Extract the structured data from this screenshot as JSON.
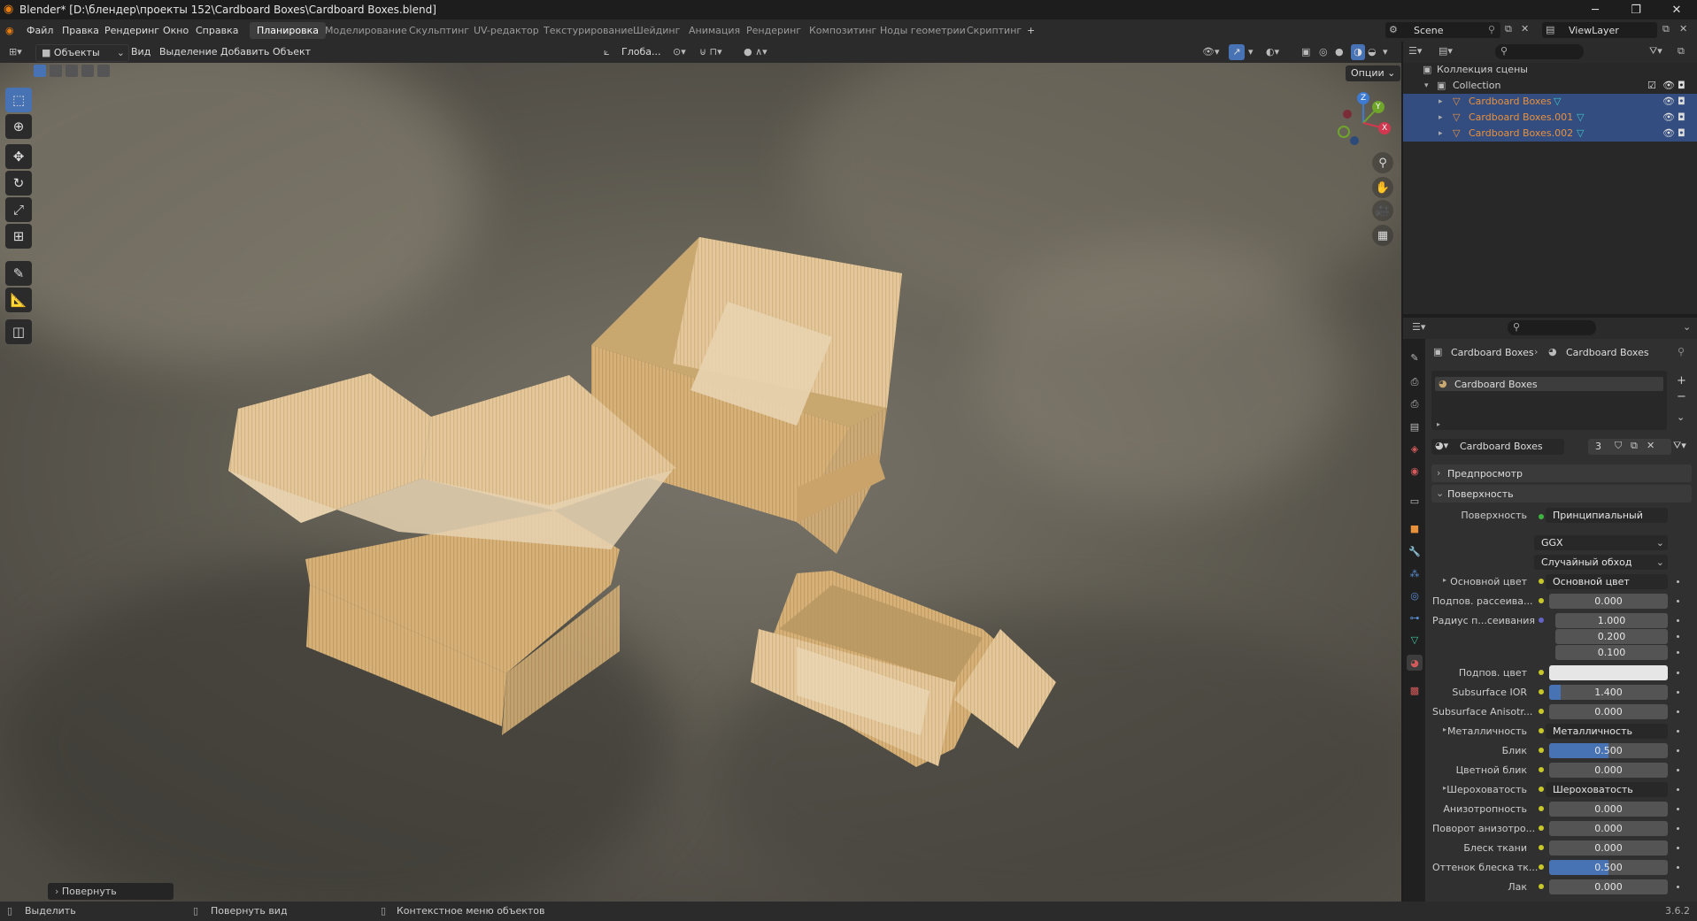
{
  "window": {
    "title": "Blender* [D:\\блендер\\проекты 152\\Cardboard Boxes\\Cardboard Boxes.blend]",
    "minimize": "─",
    "maximize": "❐",
    "close": "✕"
  },
  "menu": [
    "Файл",
    "Правка",
    "Рендеринг",
    "Окно",
    "Справка"
  ],
  "workspaces": [
    "Планировка",
    "Моделирование",
    "Скульптинг",
    "UV-редактор",
    "Текстурирование",
    "Шейдинг",
    "Анимация",
    "Рендеринг",
    "Композитинг",
    "Ноды геометрии",
    "Скриптинг"
  ],
  "workspace_add": "+",
  "scene": {
    "name": "Scene",
    "view_layer": "ViewLayer"
  },
  "viewport_header": {
    "mode": "Объекты",
    "menus": [
      "Вид",
      "Выделение",
      "Добавить",
      "Объект"
    ],
    "transform": "Глоба...",
    "options": "Опции"
  },
  "gizmo": {
    "z": "Z",
    "y": "Y",
    "x": "X"
  },
  "last_operator": "Повернуть",
  "outliner": {
    "scene_collection": "Коллекция сцены",
    "collection": "Collection",
    "objects": [
      "Cardboard Boxes",
      "Cardboard Boxes.001",
      "Cardboard Boxes.002"
    ]
  },
  "properties": {
    "breadcrumb": [
      "Cardboard Boxes",
      "Cardboard Boxes"
    ],
    "slot": "Cardboard Boxes",
    "material": "Cardboard Boxes",
    "users": "3",
    "panels": {
      "preview": "Предпросмотр",
      "surface": "Поверхность"
    },
    "surface": {
      "label": "Поверхность",
      "value": "Принципиальный BSDF"
    },
    "distribution": "GGX",
    "subsurface_method": "Случайный обход",
    "rows": [
      {
        "label": "Основной цвет",
        "value": "Основной цвет",
        "kind": "link"
      },
      {
        "label": "Подпов. рассеива...",
        "value": "0.000",
        "kind": "num",
        "fill": 0
      },
      {
        "label": "Радиус п...сеивания",
        "value": "1.000",
        "kind": "num",
        "fill": 0
      },
      {
        "label": "",
        "value": "0.200",
        "kind": "num",
        "fill": 0
      },
      {
        "label": "",
        "value": "0.100",
        "kind": "num",
        "fill": 0
      },
      {
        "label": "Подпов. цвет",
        "value": "",
        "kind": "color"
      },
      {
        "label": "Subsurface IOR",
        "value": "1.400",
        "kind": "num",
        "fill": 0.1
      },
      {
        "label": "Subsurface Anisotr...",
        "value": "0.000",
        "kind": "num",
        "fill": 0
      },
      {
        "label": "Металличность",
        "value": "Металличность",
        "kind": "link"
      },
      {
        "label": "Блик",
        "value": "0.500",
        "kind": "num",
        "fill": 0.5
      },
      {
        "label": "Цветной блик",
        "value": "0.000",
        "kind": "num",
        "fill": 0
      },
      {
        "label": "Шероховатость",
        "value": "Шероховатость",
        "kind": "link"
      },
      {
        "label": "Анизотропность",
        "value": "0.000",
        "kind": "num",
        "fill": 0
      },
      {
        "label": "Поворот анизотро...",
        "value": "0.000",
        "kind": "num",
        "fill": 0
      },
      {
        "label": "Блеск ткани",
        "value": "0.000",
        "kind": "num",
        "fill": 0
      },
      {
        "label": "Оттенок блеска тк...",
        "value": "0.500",
        "kind": "num",
        "fill": 0.5
      },
      {
        "label": "Лак",
        "value": "0.000",
        "kind": "num",
        "fill": 0
      }
    ]
  },
  "status": {
    "select": "Выделить",
    "rotate_view": "Повернуть вид",
    "context_menu": "Контекстное меню объектов",
    "version": "3.6.2"
  },
  "colors": {
    "accent": "#4772b3",
    "selected_row": "#334d80",
    "object_name": "#e8913c",
    "socket_yellow": "#c7c729",
    "socket_blue": "#6363c7"
  }
}
